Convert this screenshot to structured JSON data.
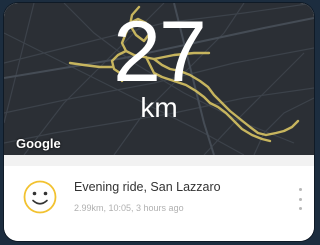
{
  "ride": {
    "distance_value": "27",
    "distance_unit": "km",
    "title": "Evening ride, San Lazzaro",
    "details": "2.99km, 10:05, 3 hours ago",
    "mood_icon": "smiley-face-icon"
  },
  "map": {
    "attribution": "Google",
    "route_color": "#d8c463"
  },
  "menu": {
    "icon": "more-vertical-icon"
  }
}
